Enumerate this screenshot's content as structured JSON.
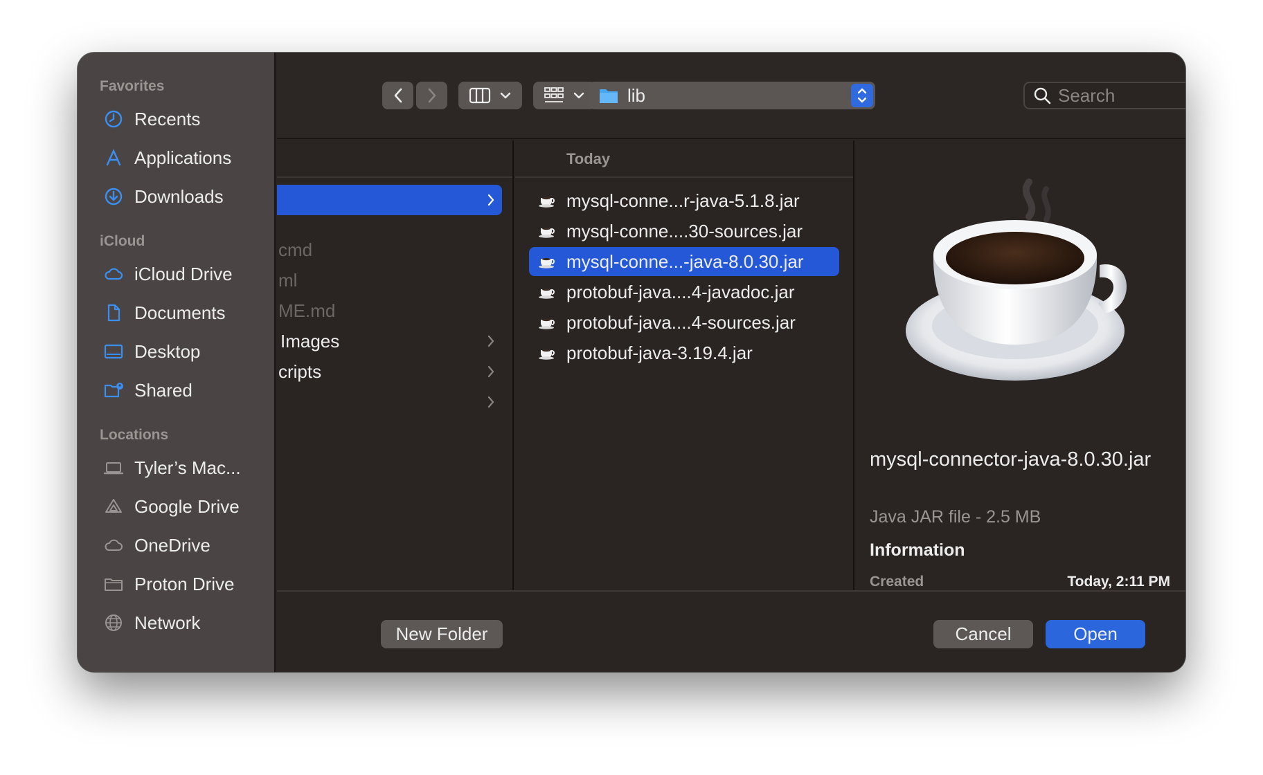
{
  "sidebar": {
    "favorites_label": "Favorites",
    "favorites": [
      {
        "label": "Recents",
        "icon": "clock-icon"
      },
      {
        "label": "Applications",
        "icon": "applications-icon"
      },
      {
        "label": "Downloads",
        "icon": "download-icon"
      }
    ],
    "icloud_label": "iCloud",
    "icloud": [
      {
        "label": "iCloud Drive",
        "icon": "cloud-icon"
      },
      {
        "label": "Documents",
        "icon": "document-icon"
      },
      {
        "label": "Desktop",
        "icon": "desktop-icon"
      },
      {
        "label": "Shared",
        "icon": "shared-folder-icon"
      }
    ],
    "locations_label": "Locations",
    "locations": [
      {
        "label": "Tyler’s Mac...",
        "icon": "laptop-icon"
      },
      {
        "label": "Google Drive",
        "icon": "google-drive-icon"
      },
      {
        "label": "OneDrive",
        "icon": "cloud-icon"
      },
      {
        "label": "Proton Drive",
        "icon": "folder-icon"
      },
      {
        "label": "Network",
        "icon": "globe-icon"
      }
    ]
  },
  "toolbar": {
    "path_name": "lib",
    "search_placeholder": "Search"
  },
  "column1": {
    "rows": [
      {
        "label": "",
        "selected": true,
        "chevron": true
      },
      {
        "label": "cmd",
        "dim": true
      },
      {
        "label": "ml",
        "dim": true
      },
      {
        "label": "ME.md",
        "dim": true
      },
      {
        "label": "Images",
        "chevron": true
      },
      {
        "label": "cripts",
        "chevron": true
      },
      {
        "label": "",
        "chevron": true
      }
    ]
  },
  "column2": {
    "header": "Today",
    "files": [
      {
        "name": "mysql-conne...r-java-5.1.8.jar"
      },
      {
        "name": "mysql-conne....30-sources.jar"
      },
      {
        "name": "mysql-conne...-java-8.0.30.jar",
        "selected": true
      },
      {
        "name": "protobuf-java....4-javadoc.jar"
      },
      {
        "name": "protobuf-java....4-sources.jar"
      },
      {
        "name": "protobuf-java-3.19.4.jar"
      }
    ]
  },
  "preview": {
    "icon": "java-coffee-cup-icon",
    "name": "mysql-connector-java-8.0.30.jar",
    "kind": "Java JAR file - 2.5 MB",
    "info_label": "Information",
    "created_label": "Created",
    "created_value": "Today, 2:11 PM"
  },
  "buttons": {
    "new_folder": "New Folder",
    "cancel": "Cancel",
    "open": "Open"
  },
  "colors": {
    "accent": "#2458d6",
    "sidebar_bg": "#4a4544",
    "window_bg": "#2a2423"
  }
}
